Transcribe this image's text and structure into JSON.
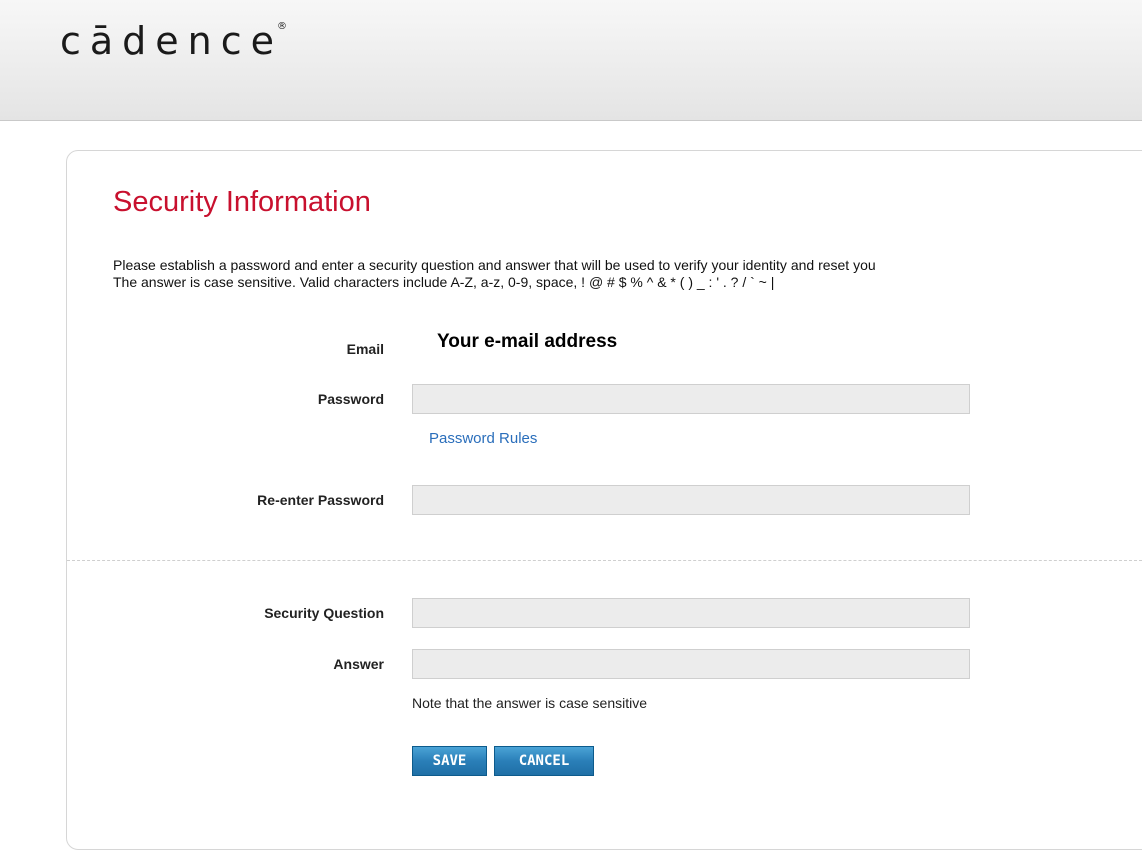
{
  "brand": {
    "logo_text": "cādence",
    "registered_mark": "®"
  },
  "page": {
    "title": "Security Information",
    "intro_line1": "Please establish a password and enter a security question and answer that will be used to verify your identity and reset you",
    "intro_line2": "The answer is case sensitive. Valid characters include A-Z, a-z, 0-9, space, ! @ # $ % ^ & * ( ) _ : ' . ? / ` ~ |"
  },
  "form": {
    "email_label": "Email",
    "email_value": "Your e-mail address",
    "password_label": "Password",
    "password_value": "",
    "password_rules_link": "Password Rules",
    "reenter_label": "Re-enter Password",
    "reenter_value": "",
    "question_label": "Security Question",
    "question_value": "",
    "answer_label": "Answer",
    "answer_value": "",
    "answer_note": "Note that the answer is case sensitive"
  },
  "actions": {
    "save_label": "SAVE",
    "cancel_label": "CANCEL"
  },
  "colors": {
    "title": "#c8102e",
    "link": "#2a6ebb",
    "button": "#2a7fb8"
  }
}
